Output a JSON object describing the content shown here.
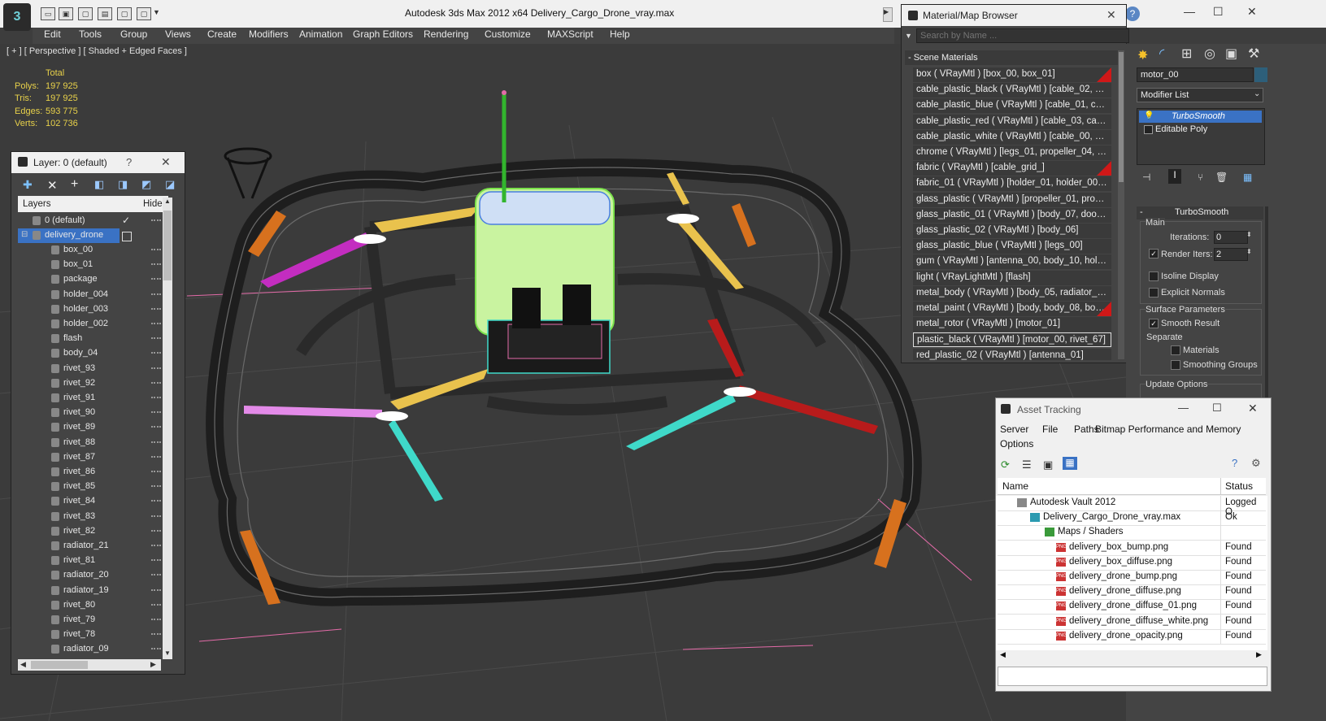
{
  "app": {
    "title": "Autodesk 3ds Max  2012 x64      Delivery_Cargo_Drone_vray.max"
  },
  "menu": [
    "Edit",
    "Tools",
    "Group",
    "Views",
    "Create",
    "Modifiers",
    "Animation",
    "Graph Editors",
    "Rendering",
    "Customize",
    "MAXScript",
    "Help"
  ],
  "viewport": {
    "label": "[ + ] [ Perspective ] [ Shaded + Edged Faces ]",
    "stats": {
      "header": "Total",
      "rows": [
        {
          "label": "Polys:",
          "value": "197 925"
        },
        {
          "label": "Tris:",
          "value": "197 925"
        },
        {
          "label": "Edges:",
          "value": "593 775"
        },
        {
          "label": "Verts:",
          "value": "102 736"
        }
      ]
    }
  },
  "layer_panel": {
    "title": "Layer: 0 (default)",
    "help": "?",
    "col_layers": "Layers",
    "col_hide": "Hide",
    "rows": [
      "0 (default)",
      "delivery_drone",
      "box_00",
      "box_01",
      "package",
      "holder_004",
      "holder_003",
      "holder_002",
      "flash",
      "body_04",
      "rivet_93",
      "rivet_92",
      "rivet_91",
      "rivet_90",
      "rivet_89",
      "rivet_88",
      "rivet_87",
      "rivet_86",
      "rivet_85",
      "rivet_84",
      "rivet_83",
      "rivet_82",
      "radiator_21",
      "rivet_81",
      "radiator_20",
      "radiator_19",
      "rivet_80",
      "rivet_79",
      "rivet_78",
      "radiator_09"
    ]
  },
  "material_browser": {
    "title": "Material/Map Browser",
    "search_placeholder": "Search by Name ...",
    "section": "- Scene Materials",
    "items": [
      "box  ( VRayMtl )  [box_00, box_01]",
      "cable_plastic_black  ( VRayMtl )  [cable_02, ca...",
      "cable_plastic_blue  ( VRayMtl )  [cable_01, cab...",
      "cable_plastic_red  ( VRayMtl )  [cable_03, cabl...",
      "cable_plastic_white  ( VRayMtl )  [cable_00, ca...",
      "chrome  ( VRayMtl )  [legs_01, propeller_04, p...",
      "fabric  ( VRayMtl )  [cable_grid_]",
      "fabric_01  ( VRayMtl )  [holder_01, holder_002...",
      "glass_plastic  ( VRayMtl )  [propeller_01, prope...",
      "glass_plastic_01  ( VRayMtl )  [body_07, door_...",
      "glass_plastic_02  ( VRayMtl )  [body_06]",
      "glass_plastic_blue  ( VRayMtl )  [legs_00]",
      "gum  ( VRayMtl )  [antenna_00, body_10, hold...",
      "light  ( VRayLightMtl )  [flash]",
      "metal_body  ( VRayMtl )  [body_05, radiator_1...",
      "metal_paint  ( VRayMtl )  [body, body_08, bod...",
      "metal_rotor  ( VRayMtl )  [motor_01]",
      "plastic_black  ( VRayMtl )  [motor_00, rivet_67]",
      "red_plastic_02  ( VRayMtl )  [antenna_01]"
    ]
  },
  "command_panel": {
    "object_name": "motor_00",
    "modifier_list": "Modifier List",
    "stack": [
      "TurboSmooth",
      "Editable Poly"
    ],
    "rollout_title": "TurboSmooth",
    "main_label": "Main",
    "iterations_label": "Iterations:",
    "iterations_value": "0",
    "render_iters_label": "Render Iters:",
    "render_iters_value": "2",
    "isoline_label": "Isoline Display",
    "explicit_label": "Explicit Normals",
    "surface_label": "Surface Parameters",
    "smooth_label": "Smooth Result",
    "separate_label": "Separate",
    "materials_label": "Materials",
    "smoothing_groups_label": "Smoothing Groups",
    "update_label": "Update Options"
  },
  "asset_tracking": {
    "title": "Asset Tracking",
    "menu": [
      "Server",
      "File",
      "Paths",
      "Bitmap Performance and Memory",
      "Options"
    ],
    "col_name": "Name",
    "col_status": "Status",
    "rows": [
      {
        "name": "Autodesk Vault 2012",
        "status": "Logged O",
        "indent": 24,
        "icon": "vault"
      },
      {
        "name": "Delivery_Cargo_Drone_vray.max",
        "status": "Ok",
        "indent": 40,
        "icon": "max"
      },
      {
        "name": "Maps / Shaders",
        "status": "",
        "indent": 58,
        "icon": "maps"
      },
      {
        "name": "delivery_box_bump.png",
        "status": "Found",
        "indent": 72,
        "icon": "png"
      },
      {
        "name": "delivery_box_diffuse.png",
        "status": "Found",
        "indent": 72,
        "icon": "png"
      },
      {
        "name": "delivery_drone_bump.png",
        "status": "Found",
        "indent": 72,
        "icon": "png"
      },
      {
        "name": "delivery_drone_diffuse.png",
        "status": "Found",
        "indent": 72,
        "icon": "png"
      },
      {
        "name": "delivery_drone_diffuse_01.png",
        "status": "Found",
        "indent": 72,
        "icon": "png"
      },
      {
        "name": "delivery_drone_diffuse_white.png",
        "status": "Found",
        "indent": 72,
        "icon": "png"
      },
      {
        "name": "delivery_drone_opacity.png",
        "status": "Found",
        "indent": 72,
        "icon": "png"
      }
    ]
  }
}
